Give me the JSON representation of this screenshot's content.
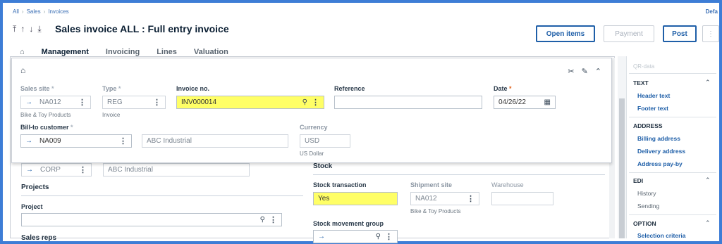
{
  "breadcrumb": {
    "items": [
      "All",
      "Sales",
      "Invoices"
    ],
    "right_text": "Defa"
  },
  "header": {
    "title": "Sales invoice ALL : Full entry invoice",
    "buttons": {
      "open_items": "Open items",
      "payment": "Payment",
      "post": "Post"
    }
  },
  "tabs": [
    "Management",
    "Invoicing",
    "Lines",
    "Valuation"
  ],
  "overlay": {
    "sales_site": {
      "label": "Sales site",
      "value": "NA012",
      "sub": "Bike & Toy Products"
    },
    "type": {
      "label": "Type",
      "value": "REG",
      "sub": "Invoice"
    },
    "invoice_no": {
      "label": "Invoice no.",
      "value": "INV000014"
    },
    "reference": {
      "label": "Reference",
      "value": ""
    },
    "date": {
      "label": "Date",
      "value": "04/26/22"
    },
    "bill_to": {
      "label": "Bill-to customer",
      "value": "NA009",
      "name": "ABC Industrial"
    },
    "currency": {
      "label": "Currency",
      "value": "USD",
      "sub": "US Dollar"
    }
  },
  "below": {
    "corp_value": "CORP",
    "corp_name": "ABC Industrial",
    "projects_title": "Projects",
    "project_label": "Project",
    "sales_reps_title": "Sales reps",
    "stock_title": "Stock",
    "stock_transaction": {
      "label": "Stock transaction",
      "value": "Yes"
    },
    "shipment_site": {
      "label": "Shipment site",
      "value": "NA012",
      "sub": "Bike & Toy Products"
    },
    "warehouse": {
      "label": "Warehouse",
      "value": ""
    },
    "stock_movement_group": {
      "label": "Stock movement group"
    }
  },
  "sidebar": {
    "faded": "QR-data",
    "sections": [
      {
        "title": "TEXT",
        "items": [
          "Header text",
          "Footer text"
        ]
      },
      {
        "title": "ADDRESS",
        "items": [
          "Billing address",
          "Delivery address",
          "Address pay-by"
        ]
      },
      {
        "title": "EDI",
        "items": [
          "History",
          "Sending"
        ]
      },
      {
        "title": "OPTION",
        "items": [
          "Selection criteria"
        ]
      }
    ]
  },
  "colors": {
    "accent": "#1f5fa8",
    "highlight": "#ffff66",
    "required": "#e0621a",
    "frame": "#3d7dd6"
  }
}
